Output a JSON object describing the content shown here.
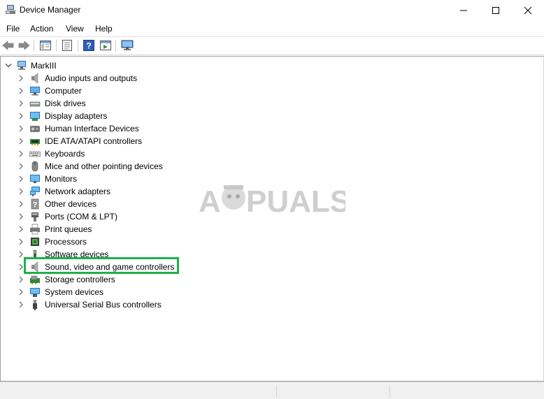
{
  "window": {
    "title": "Device Manager",
    "controls": {
      "minimize": "minimize",
      "maximize": "maximize",
      "close": "close"
    }
  },
  "menubar": {
    "items": [
      "File",
      "Action",
      "View",
      "Help"
    ]
  },
  "toolbar": {
    "buttons": [
      "back-icon",
      "forward-icon",
      "show-hide-console-tree-icon",
      "properties-icon",
      "help-icon",
      "run-icon",
      "computer-monitor-icon"
    ]
  },
  "tree": {
    "root": {
      "label": "MarkIII",
      "expanded": true
    },
    "items": [
      {
        "label": "Audio inputs and outputs",
        "icon": "speaker-icon"
      },
      {
        "label": "Computer",
        "icon": "computer-icon"
      },
      {
        "label": "Disk drives",
        "icon": "disk-drive-icon"
      },
      {
        "label": "Display adapters",
        "icon": "display-adapter-icon"
      },
      {
        "label": "Human Interface Devices",
        "icon": "hid-icon"
      },
      {
        "label": "IDE ATA/ATAPI controllers",
        "icon": "ide-controller-icon"
      },
      {
        "label": "Keyboards",
        "icon": "keyboard-icon"
      },
      {
        "label": "Mice and other pointing devices",
        "icon": "mouse-icon"
      },
      {
        "label": "Monitors",
        "icon": "monitor-icon"
      },
      {
        "label": "Network adapters",
        "icon": "network-adapter-icon"
      },
      {
        "label": "Other devices",
        "icon": "other-devices-icon"
      },
      {
        "label": "Ports (COM & LPT)",
        "icon": "port-icon"
      },
      {
        "label": "Print queues",
        "icon": "printer-icon"
      },
      {
        "label": "Processors",
        "icon": "processor-icon"
      },
      {
        "label": "Software devices",
        "icon": "software-device-icon"
      },
      {
        "label": "Sound, video and game controllers",
        "icon": "speaker-icon",
        "highlighted": true
      },
      {
        "label": "Storage controllers",
        "icon": "storage-controller-icon"
      },
      {
        "label": "System devices",
        "icon": "system-device-icon"
      },
      {
        "label": "Universal Serial Bus controllers",
        "icon": "usb-icon"
      }
    ]
  },
  "watermark": {
    "text": "A PUALS"
  },
  "colors": {
    "highlight": "#1fb04a",
    "accent_blue": "#1e7cd6"
  }
}
